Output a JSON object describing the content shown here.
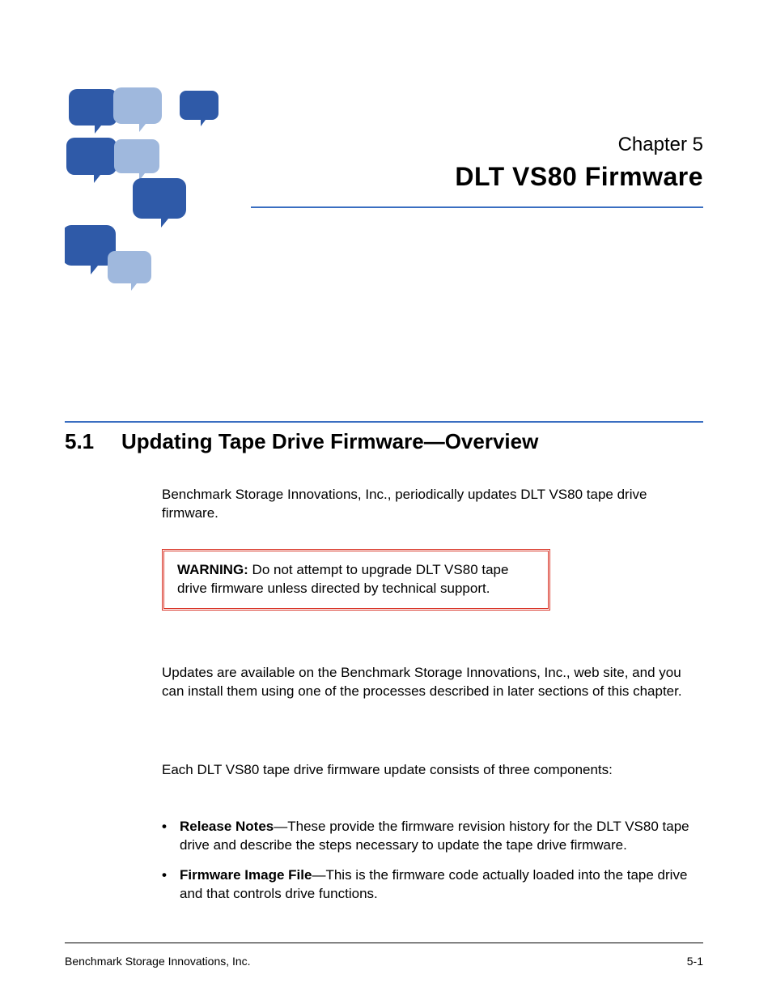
{
  "chapter": {
    "label": "Chapter 5",
    "title": "DLT VS80 Firmware"
  },
  "section": {
    "number": "5.1",
    "title": "Updating Tape Drive Firmware—Overview"
  },
  "paragraphs": {
    "p1": "Benchmark Storage Innovations, Inc., periodically updates DLT VS80 tape drive firmware.",
    "p2": "Updates are available on the Benchmark Storage Innovations, Inc., web site, and you can install them using one of the processes described in later sections of this chapter.",
    "p3": "Each DLT VS80 tape drive firmware update consists of three components:"
  },
  "warning": {
    "label": "WARNING:",
    "text": " Do not attempt to upgrade DLT VS80 tape drive firmware unless directed by technical support."
  },
  "bullets": [
    {
      "strong": "Release Notes",
      "rest": "—These provide the firmware revision history for the DLT VS80 tape drive and describe the steps necessary to update the tape drive firmware."
    },
    {
      "strong": "Firmware Image File",
      "rest": "—This is the firmware code actually loaded into the tape drive and that controls drive functions."
    }
  ],
  "footer": {
    "left": "Benchmark Storage Innovations, Inc.",
    "right": "5-1"
  },
  "colors": {
    "rule": "#3a6ec1",
    "warning_border": "#d9372a"
  }
}
